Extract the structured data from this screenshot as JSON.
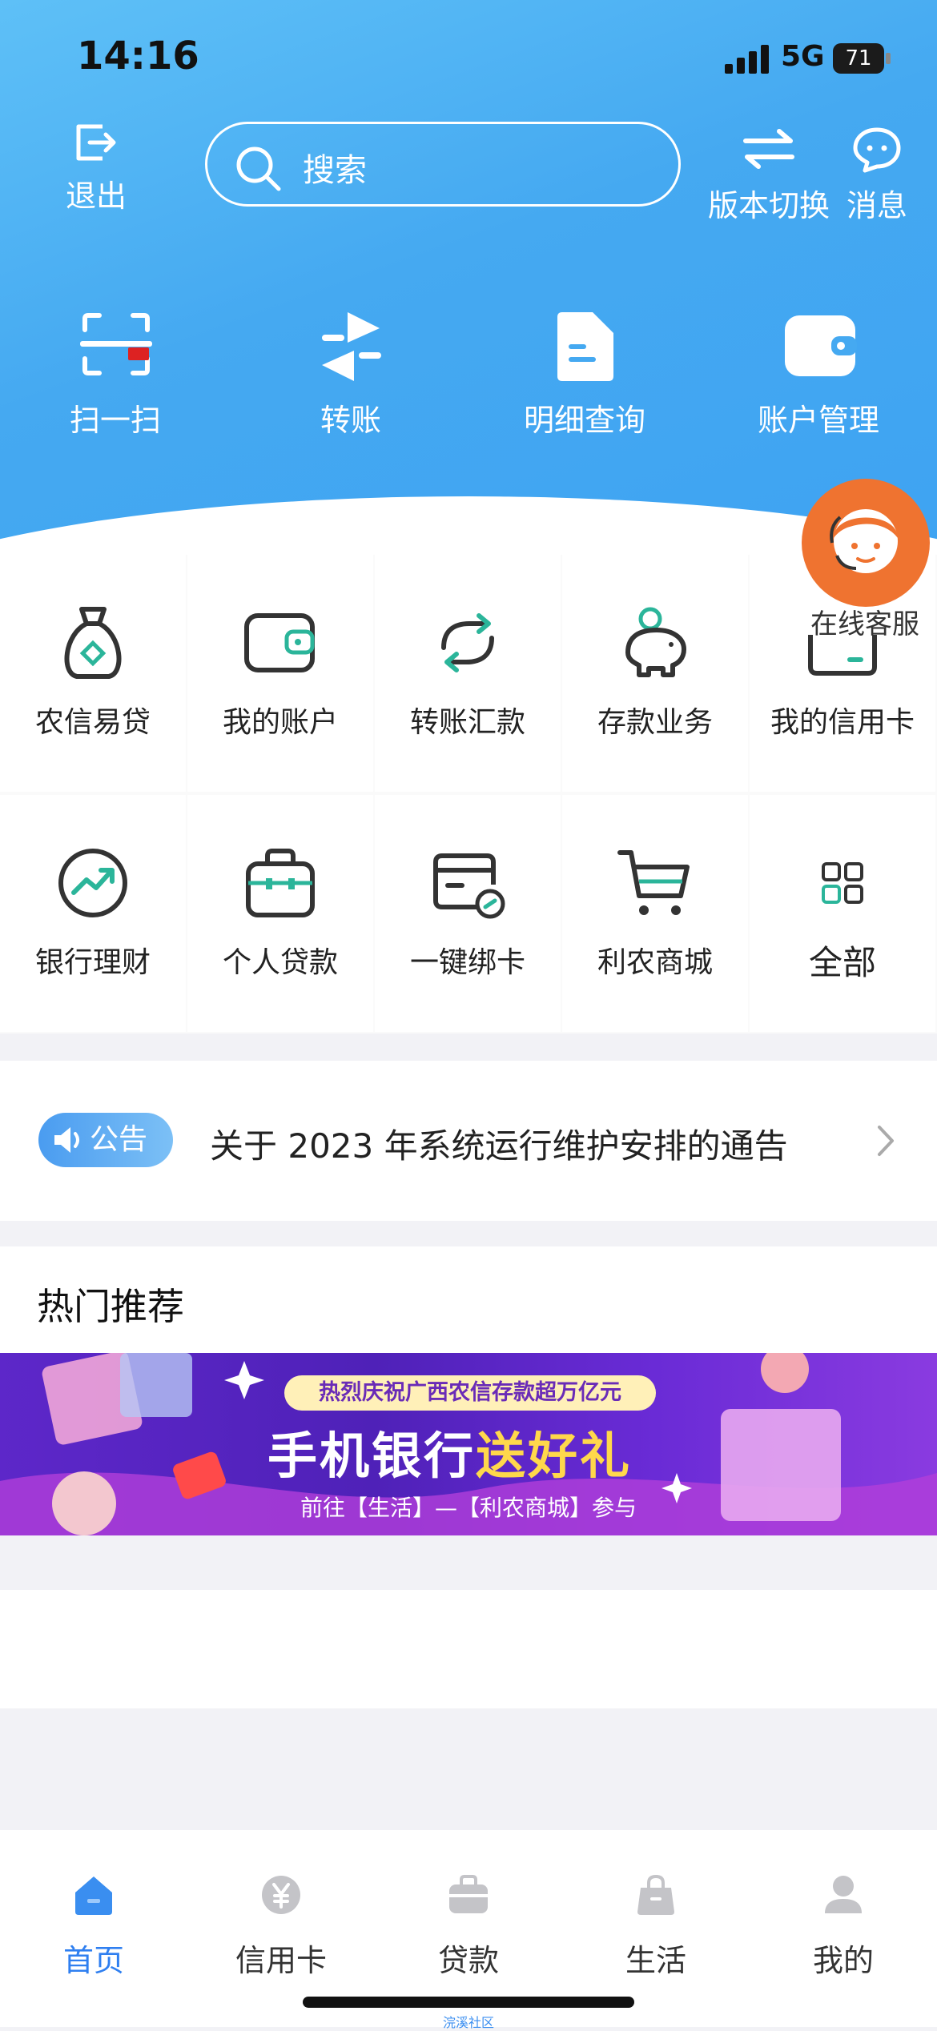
{
  "status": {
    "time": "14:16",
    "network": "5G",
    "battery": "71"
  },
  "header": {
    "logout_label": "退出",
    "search_placeholder": "搜索",
    "switch_label": "版本切换",
    "message_label": "消息"
  },
  "quick": [
    {
      "label": "扫一扫",
      "icon": "scan-icon"
    },
    {
      "label": "转账",
      "icon": "transfer-icon"
    },
    {
      "label": "明细查询",
      "icon": "statement-icon"
    },
    {
      "label": "账户管理",
      "icon": "wallet-icon"
    }
  ],
  "grid": [
    {
      "label": "农信易贷",
      "icon": "money-bag-icon"
    },
    {
      "label": "我的账户",
      "icon": "wallet-icon"
    },
    {
      "label": "转账汇款",
      "icon": "exchange-icon"
    },
    {
      "label": "存款业务",
      "icon": "piggy-bank-icon"
    },
    {
      "label": "我的信用卡",
      "icon": "credit-card-icon"
    },
    {
      "label": "银行理财",
      "icon": "trend-icon"
    },
    {
      "label": "个人贷款",
      "icon": "briefcase-icon"
    },
    {
      "label": "一键绑卡",
      "icon": "bind-card-icon"
    },
    {
      "label": "利农商城",
      "icon": "cart-icon"
    },
    {
      "label": "全部",
      "icon": "grid-icon"
    }
  ],
  "support": {
    "label": "在线客服"
  },
  "notice": {
    "badge": "公告",
    "text": "关于 2023 年系统运行维护安排的通告"
  },
  "hot": {
    "title": "热门推荐",
    "banner": {
      "pill": "热烈庆祝广西农信存款超万亿元",
      "title_a": "手机银行",
      "title_b": "送好礼",
      "sub": "前往【生活】—【利农商城】参与"
    }
  },
  "tabs": [
    {
      "label": "首页",
      "icon": "home-icon",
      "active": true
    },
    {
      "label": "信用卡",
      "icon": "yen-card-icon",
      "active": false
    },
    {
      "label": "贷款",
      "icon": "loan-briefcase-icon",
      "active": false
    },
    {
      "label": "生活",
      "icon": "shopping-bag-icon",
      "active": false
    },
    {
      "label": "我的",
      "icon": "profile-icon",
      "active": false
    }
  ],
  "footer_tiny": "浣溪社区",
  "colors": {
    "accent": "#2f7ff0",
    "green": "#2bb59a",
    "orange": "#ef7330"
  }
}
